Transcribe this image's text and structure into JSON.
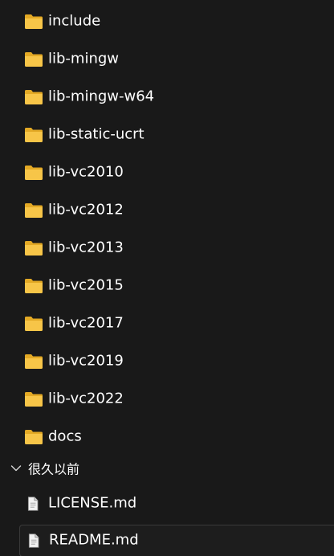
{
  "folders": [
    {
      "name": "include",
      "icon": "folder-icon"
    },
    {
      "name": "lib-mingw",
      "icon": "folder-icon"
    },
    {
      "name": "lib-mingw-w64",
      "icon": "folder-icon"
    },
    {
      "name": "lib-static-ucrt",
      "icon": "folder-icon"
    },
    {
      "name": "lib-vc2010",
      "icon": "folder-icon"
    },
    {
      "name": "lib-vc2012",
      "icon": "folder-icon"
    },
    {
      "name": "lib-vc2013",
      "icon": "folder-icon"
    },
    {
      "name": "lib-vc2015",
      "icon": "folder-icon"
    },
    {
      "name": "lib-vc2017",
      "icon": "folder-icon"
    },
    {
      "name": "lib-vc2019",
      "icon": "folder-icon"
    },
    {
      "name": "lib-vc2022",
      "icon": "folder-icon"
    },
    {
      "name": "docs",
      "icon": "folder-icon"
    }
  ],
  "group": {
    "label": "很久以前",
    "expanded": true,
    "icon": "chevron-down-icon"
  },
  "files": [
    {
      "name": "LICENSE.md",
      "icon": "file-icon",
      "selected": false
    },
    {
      "name": "README.md",
      "icon": "file-icon",
      "selected": true
    }
  ],
  "colors": {
    "background": "#191919",
    "text": "#ffffff",
    "folder": "#f7c548",
    "folder_back": "#e3a925",
    "selection_border": "#3a3a3a"
  }
}
